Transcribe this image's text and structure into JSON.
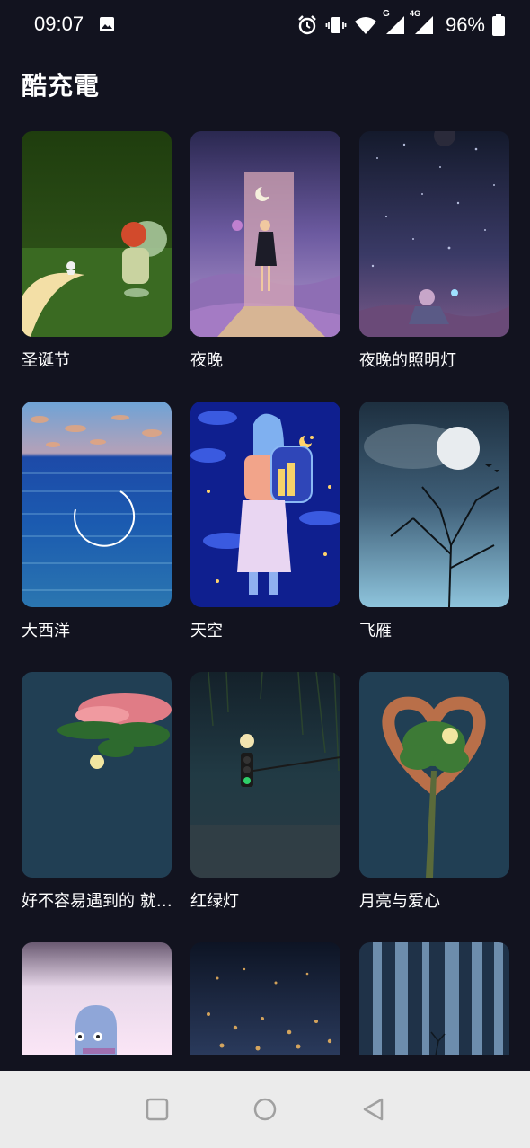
{
  "status_bar": {
    "time": "09:07",
    "signal_g_label": "G",
    "signal_4g_label": "4G",
    "battery": "96%"
  },
  "header": {
    "title": "酷充電"
  },
  "wallpapers": [
    {
      "label": "圣诞节"
    },
    {
      "label": "夜晚"
    },
    {
      "label": "夜晚的照明灯"
    },
    {
      "label": "大西洋"
    },
    {
      "label": "天空"
    },
    {
      "label": "飞雁"
    },
    {
      "label": "好不容易遇到的 就…"
    },
    {
      "label": "红绿灯"
    },
    {
      "label": "月亮与爱心"
    }
  ],
  "colors": {
    "background": "#12131f",
    "nav_background": "#ebebeb",
    "nav_icon": "#a0a0a0"
  }
}
